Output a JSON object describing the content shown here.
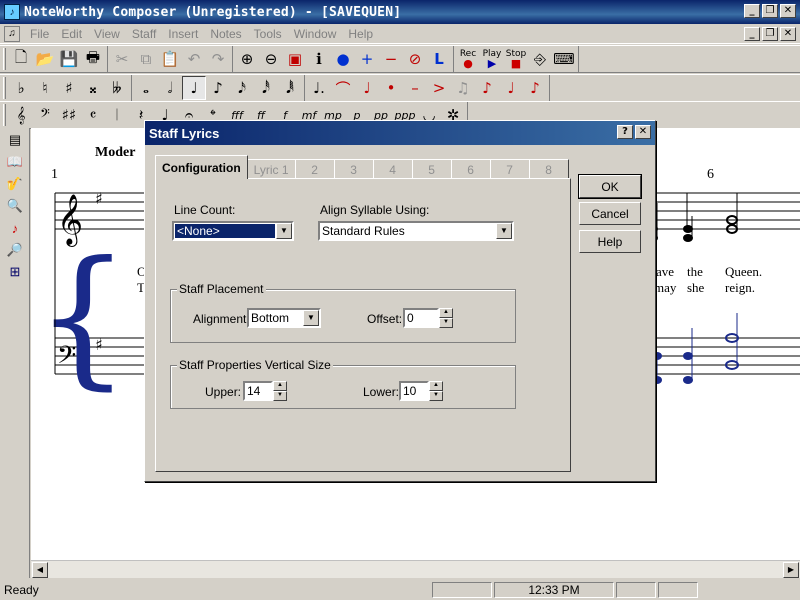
{
  "window": {
    "title": "NoteWorthy Composer (Unregistered) - [SAVEQUEN]",
    "app_icon": "piano-keys-icon",
    "controls": [
      "_",
      "❐",
      "✕"
    ]
  },
  "menu": {
    "items": [
      "File",
      "Edit",
      "View",
      "Staff",
      "Insert",
      "Notes",
      "Tools",
      "Window",
      "Help"
    ]
  },
  "toolbar_main": {
    "play_labels": [
      "Rec",
      "Play",
      "Stop"
    ]
  },
  "score": {
    "tempo_text": "Moder",
    "measure_numbers": [
      "1",
      "6"
    ],
    "lyrics_left": [
      "O",
      "T"
    ],
    "lyrics_right_line1": [
      "ave",
      "the",
      "Queen."
    ],
    "lyrics_right_line2": [
      "may",
      "she",
      "reign."
    ]
  },
  "dialog": {
    "title": "Staff Lyrics",
    "help_glyph": "?",
    "close_glyph": "✕",
    "tabs": [
      "Configuration",
      "Lyric 1",
      "2",
      "3",
      "4",
      "5",
      "6",
      "7",
      "8"
    ],
    "line_count_label": "Line Count:",
    "line_count_value": "<None>",
    "align_label": "Align Syllable Using:",
    "align_value": "Standard Rules",
    "placement": {
      "title": "Staff Placement",
      "alignment_label": "Alignment:",
      "alignment_value": "Bottom",
      "offset_label": "Offset:",
      "offset_value": "0"
    },
    "vsize": {
      "title": "Staff Properties Vertical Size",
      "upper_label": "Upper:",
      "upper_value": "14",
      "lower_label": "Lower:",
      "lower_value": "10"
    },
    "buttons": {
      "ok": "OK",
      "cancel": "Cancel",
      "help": "Help"
    }
  },
  "status": {
    "text": "Ready",
    "time": "12:33 PM"
  }
}
